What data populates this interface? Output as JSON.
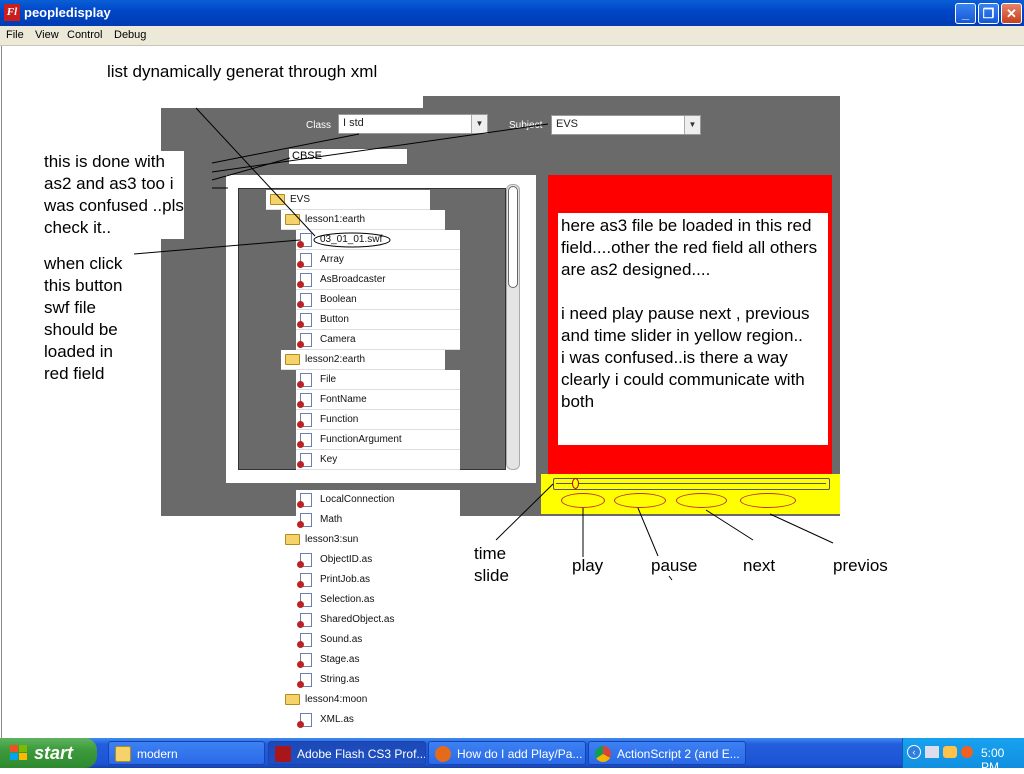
{
  "window": {
    "title": "peopledisplay",
    "app_icon": "Fl"
  },
  "menu": [
    "File",
    "View",
    "Control",
    "Debug"
  ],
  "form": {
    "class_label": "Class",
    "class_value": "I std",
    "subject_label": "Subject",
    "subject_value": "EVS",
    "board_value": "CBSE"
  },
  "tree": {
    "root": "EVS",
    "items": [
      {
        "label": "lesson1:earth",
        "type": "folder"
      },
      {
        "label": "03_01_01.swf",
        "type": "file"
      },
      {
        "label": "Array",
        "type": "file"
      },
      {
        "label": "AsBroadcaster",
        "type": "file"
      },
      {
        "label": "Boolean",
        "type": "file"
      },
      {
        "label": "Button",
        "type": "file"
      },
      {
        "label": "Camera",
        "type": "file"
      },
      {
        "label": "lesson2:earth",
        "type": "folder"
      },
      {
        "label": "File",
        "type": "file"
      },
      {
        "label": "FontName",
        "type": "file"
      },
      {
        "label": "Function",
        "type": "file"
      },
      {
        "label": "FunctionArgument",
        "type": "file"
      },
      {
        "label": "Key",
        "type": "file"
      }
    ],
    "overflow_items": [
      {
        "label": "LocalConnection",
        "type": "file"
      },
      {
        "label": "Math",
        "type": "file"
      },
      {
        "label": "lesson3:sun",
        "type": "folder"
      },
      {
        "label": "ObjectID.as",
        "type": "file"
      },
      {
        "label": "PrintJob.as",
        "type": "file"
      },
      {
        "label": "Selection.as",
        "type": "file"
      },
      {
        "label": "SharedObject.as",
        "type": "file"
      },
      {
        "label": "Sound.as",
        "type": "file"
      },
      {
        "label": "Stage.as",
        "type": "file"
      },
      {
        "label": "String.as",
        "type": "file"
      },
      {
        "label": "lesson4:moon",
        "type": "folder"
      },
      {
        "label": "XML.as",
        "type": "file"
      }
    ]
  },
  "red_field_text": "here as3 file be loaded in this red field....other the red field all others are as2 designed....\n\ni need play pause next , previous and time slider in yellow region..\ni was confused..is there a way clearly i could communicate with both",
  "annotations": {
    "list_note": "list dynamically generat through xml",
    "as2_note": "this is done with\nas2 and as3 too i\nwas confused ..pls\ncheck it..",
    "click_note": "when click\nthis button\nswf file\nshould be\nloaded in\nred field",
    "time_slide": "time\nslide",
    "play": "play",
    "pause": "pause",
    "next": "next",
    "previos": "previos"
  },
  "taskbar": {
    "start": "start",
    "tasks": [
      {
        "label": "modern",
        "icon": "folder-icon"
      },
      {
        "label": "Adobe Flash CS3 Prof...",
        "icon": "flash-icon"
      },
      {
        "label": "How do I add Play/Pa...",
        "icon": "firefox-icon"
      },
      {
        "label": "ActionScript 2 (and E...",
        "icon": "chrome-icon"
      }
    ],
    "clock": "5:00 PM"
  },
  "colors": {
    "red_field": "#ff0000",
    "yellow_region": "#ffff00",
    "panel_gray": "#6a6a6a"
  }
}
